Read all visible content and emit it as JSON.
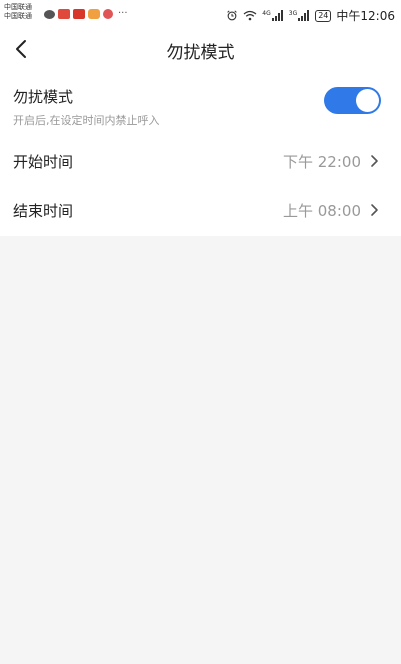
{
  "status_bar": {
    "carrier_1": "中国联通",
    "carrier_2": "中国联通",
    "more": "···",
    "network_1": "4G",
    "network_2": "3G",
    "battery": "24",
    "time": "中午12:06"
  },
  "header": {
    "title": "勿扰模式"
  },
  "dnd": {
    "title": "勿扰模式",
    "description": "开启后,在设定时间内禁止呼入",
    "enabled": true,
    "toggle_color": "#2f7ae8"
  },
  "start_time": {
    "label": "开始时间",
    "value": "下午 22:00"
  },
  "end_time": {
    "label": "结束时间",
    "value": "上午 08:00"
  }
}
